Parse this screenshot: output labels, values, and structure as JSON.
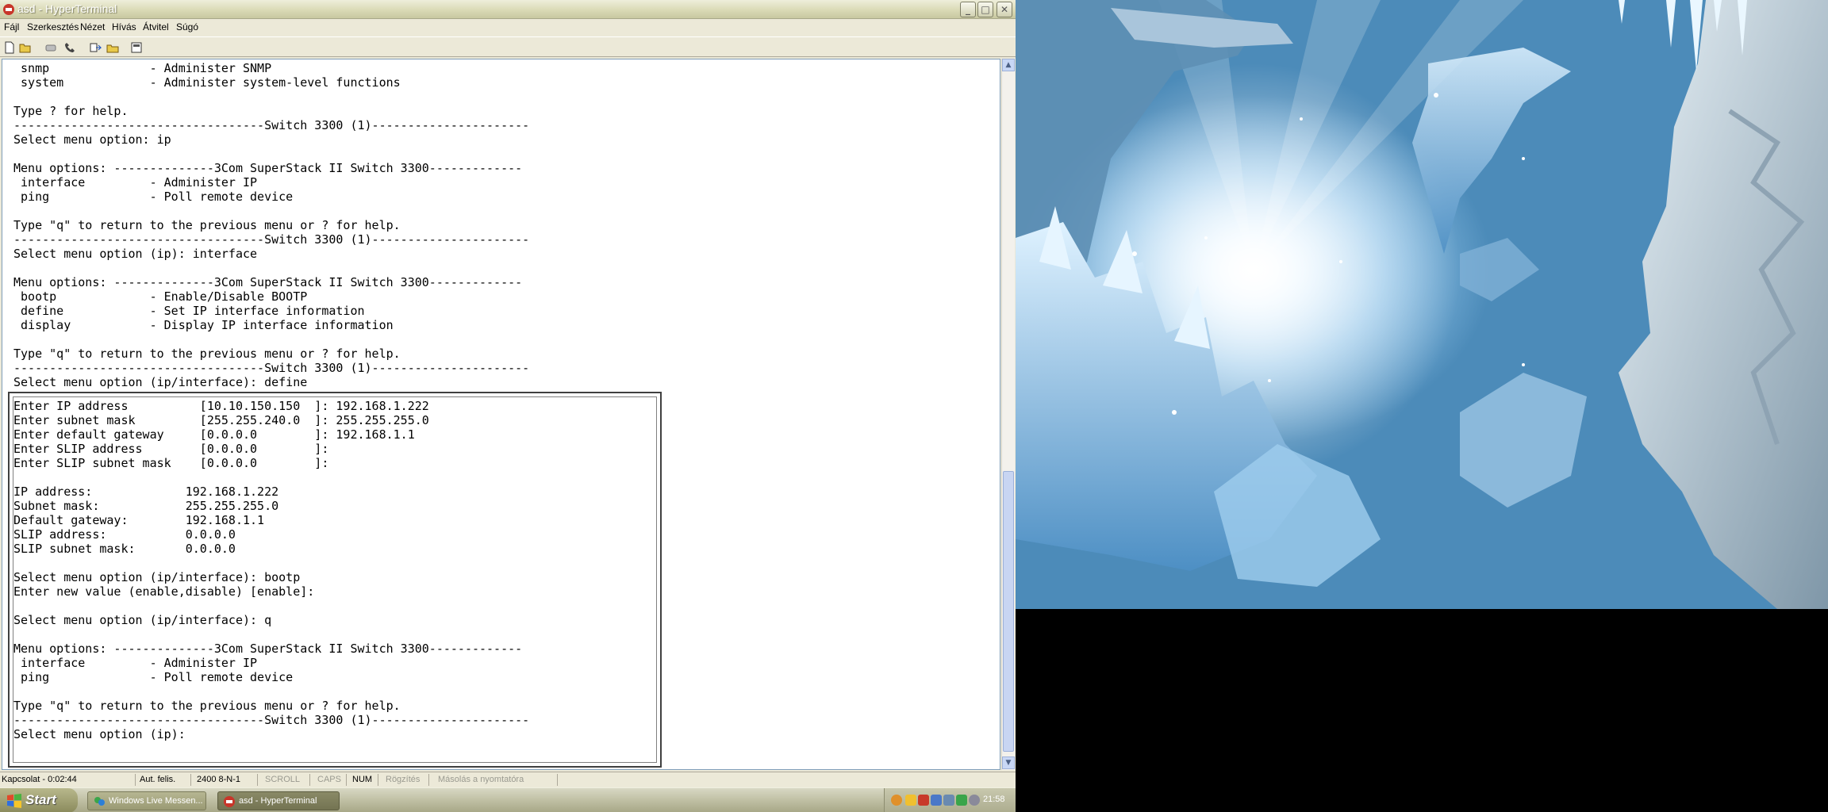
{
  "window": {
    "title": "asd - HyperTerminal",
    "menu": [
      "Fájl",
      "Szerkesztés",
      "Nézet",
      "Hívás",
      "Átvitel",
      "Súgó"
    ],
    "toolbar_icons": [
      "new-icon",
      "open-icon",
      "disconnect-icon",
      "phone-icon",
      "send-icon",
      "receive-icon",
      "properties-icon"
    ]
  },
  "terminal": {
    "lines": [
      " snmp              - Administer SNMP",
      " system            - Administer system-level functions",
      "",
      "Type ? for help.",
      "-----------------------------------Switch 3300 (1)----------------------",
      "Select menu option: ip",
      "",
      "Menu options: --------------3Com SuperStack II Switch 3300-------------",
      " interface         - Administer IP",
      " ping              - Poll remote device",
      "",
      "Type \"q\" to return to the previous menu or ? for help.",
      "-----------------------------------Switch 3300 (1)----------------------",
      "Select menu option (ip): interface",
      "",
      "Menu options: --------------3Com SuperStack II Switch 3300-------------",
      " bootp             - Enable/Disable BOOTP",
      " define            - Set IP interface information",
      " display           - Display IP interface information",
      "",
      "Type \"q\" to return to the previous menu or ? for help.",
      "-----------------------------------Switch 3300 (1)----------------------",
      "Select menu option (ip/interface): define"
    ],
    "dialog_lines": [
      "Enter IP address          [10.10.150.150  ]: 192.168.1.222",
      "Enter subnet mask         [255.255.240.0  ]: 255.255.255.0",
      "Enter default gateway     [0.0.0.0        ]: 192.168.1.1",
      "Enter SLIP address        [0.0.0.0        ]:",
      "Enter SLIP subnet mask    [0.0.0.0        ]:",
      "",
      "IP address:             192.168.1.222",
      "Subnet mask:            255.255.255.0",
      "Default gateway:        192.168.1.1",
      "SLIP address:           0.0.0.0",
      "SLIP subnet mask:       0.0.0.0",
      "",
      "Select menu option (ip/interface): bootp",
      "Enter new value (enable,disable) [enable]:",
      "",
      "Select menu option (ip/interface): q",
      "",
      "Menu options: --------------3Com SuperStack II Switch 3300-------------",
      " interface         - Administer IP",
      " ping              - Poll remote device",
      "",
      "Type \"q\" to return to the previous menu or ? for help.",
      "-----------------------------------Switch 3300 (1)----------------------",
      "Select menu option (ip):"
    ]
  },
  "status": {
    "connection": "Kapcsolat - 0:02:44",
    "detect": "Aut. felis.",
    "settings": "2400 8-N-1",
    "scroll": "SCROLL",
    "caps": "CAPS",
    "num": "NUM",
    "capture": "Rögzítés",
    "print_echo": "Másolás a nyomtatóra"
  },
  "taskbar": {
    "start": "Start",
    "tasks": [
      "Windows Live Messen...",
      "asd - HyperTerminal"
    ],
    "clock": "21:58"
  }
}
